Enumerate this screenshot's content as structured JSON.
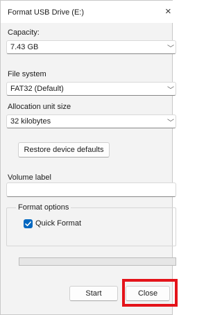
{
  "window": {
    "title": "Format USB Drive (E:)",
    "close_glyph": "×"
  },
  "capacity": {
    "label": "Capacity:",
    "value": "7.43 GB"
  },
  "file_system": {
    "label": "File system",
    "value": "FAT32 (Default)"
  },
  "allocation_unit": {
    "label": "Allocation unit size",
    "value": "32 kilobytes"
  },
  "restore_defaults_label": "Restore device defaults",
  "volume_label": {
    "label": "Volume label",
    "value": ""
  },
  "format_options": {
    "title": "Format options",
    "quick_format": {
      "label": "Quick Format",
      "checked": true
    }
  },
  "progress": {
    "value": 0
  },
  "buttons": {
    "start_label": "Start",
    "close_label": "Close"
  },
  "chevron_glyph": "﹀",
  "colors": {
    "accent": "#0067c0",
    "highlight": "#e4131a"
  }
}
